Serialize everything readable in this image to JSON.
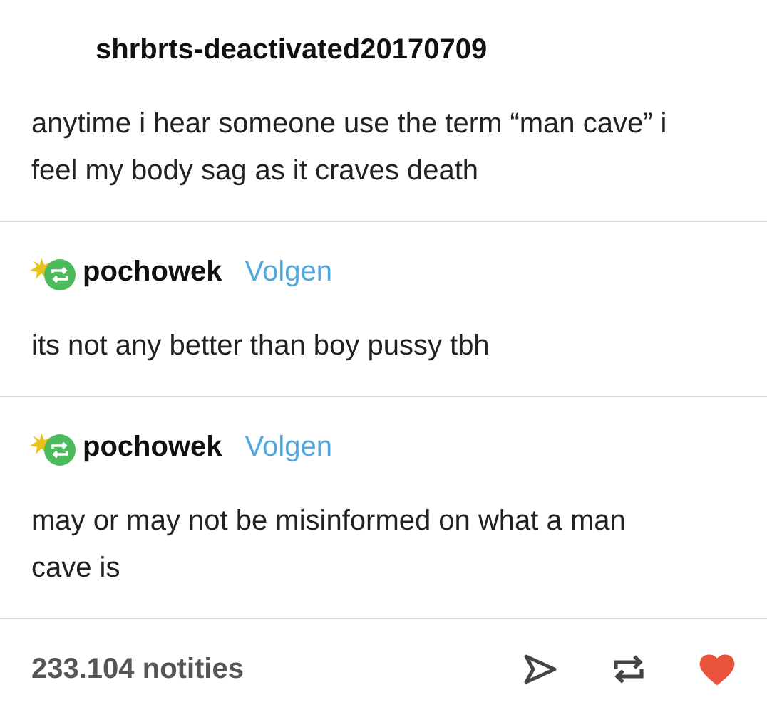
{
  "posts": [
    {
      "username": "shrbrts-deactivated20170709",
      "show_avatar": false,
      "text": "anytime i hear someone use the term “man cave” i feel my body sag as it craves death"
    },
    {
      "username": "pochowek",
      "show_avatar": true,
      "follow": "Volgen",
      "text": "its not any better than boy pussy tbh"
    },
    {
      "username": "pochowek",
      "show_avatar": true,
      "follow": "Volgen",
      "text": "may or may not be misinformed on what a man cave is"
    }
  ],
  "footer": {
    "notes": "233.104 notities",
    "liked": true
  }
}
